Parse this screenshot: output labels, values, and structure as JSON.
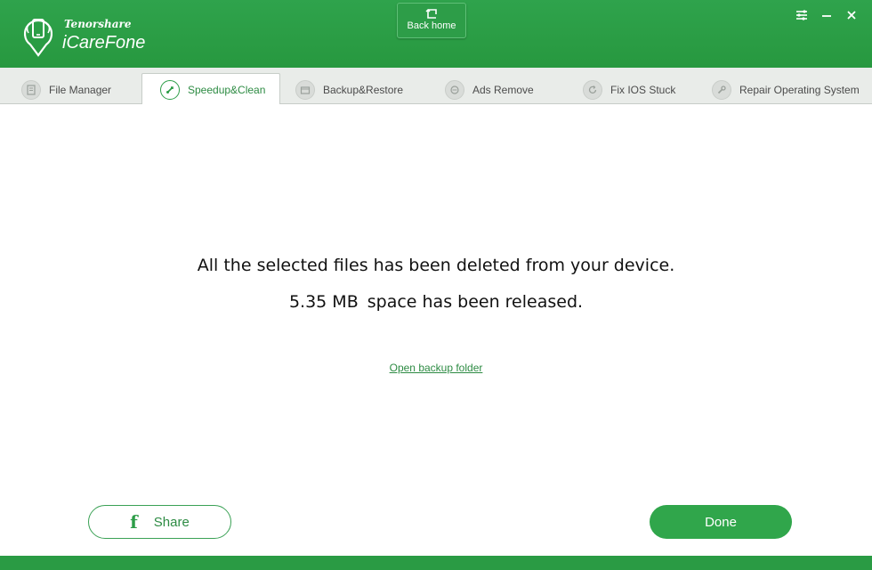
{
  "header": {
    "brand_small": "Tenorshare",
    "brand_main": "iCareFone",
    "back_home_label": "Back home",
    "icons": [
      "phone-logo-icon",
      "back-home-icon",
      "menu-icon",
      "minimize-icon",
      "close-icon"
    ]
  },
  "tabs": [
    {
      "label": "File Manager",
      "icon": "file-manager-icon",
      "active": false
    },
    {
      "label": "Speedup&Clean",
      "icon": "rocket-icon",
      "active": true
    },
    {
      "label": "Backup&Restore",
      "icon": "backup-icon",
      "active": false
    },
    {
      "label": "Ads Remove",
      "icon": "ads-remove-icon",
      "active": false
    },
    {
      "label": "Fix IOS Stuck",
      "icon": "refresh-icon",
      "active": false
    },
    {
      "label": "Repair Operating System",
      "icon": "wrench-icon",
      "active": false
    }
  ],
  "main": {
    "message_line1": "All the selected files has been deleted from your device.",
    "released_size": "5.35 MB",
    "message_line2_suffix": "space has been released.",
    "backup_link": "Open backup folder"
  },
  "actions": {
    "share_label": "Share",
    "done_label": "Done"
  },
  "colors": {
    "brand_green": "#2fa34c",
    "accent_green": "#30a64b",
    "link_green": "#2d8b43"
  }
}
